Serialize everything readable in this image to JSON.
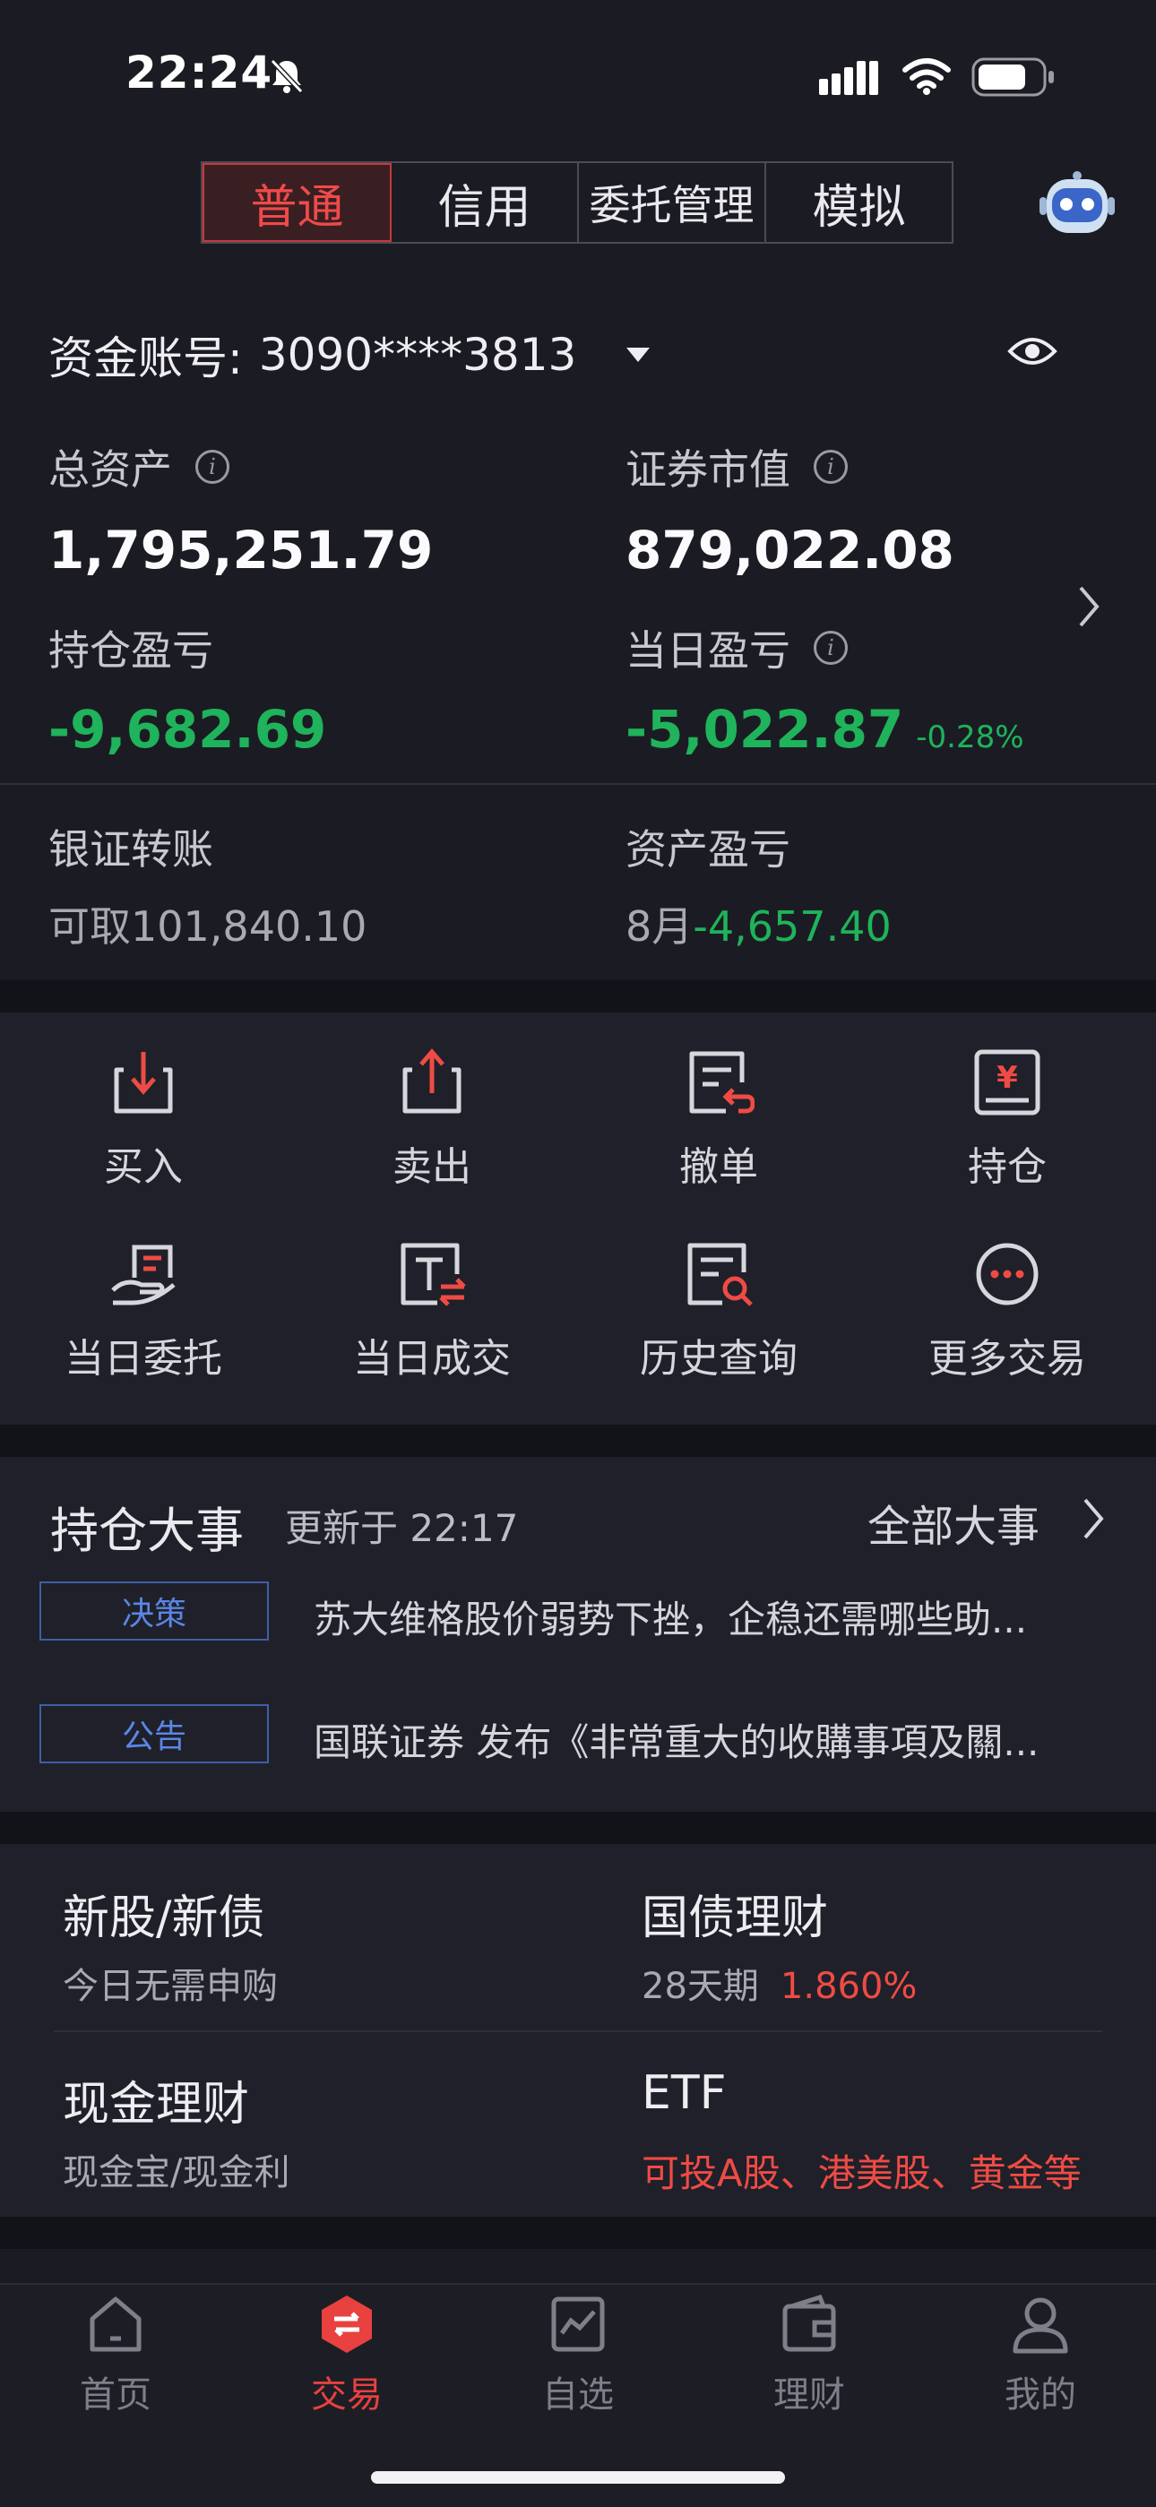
{
  "status": {
    "time": "22:24"
  },
  "tabs": [
    {
      "label": "普通",
      "active": true
    },
    {
      "label": "信用",
      "active": false
    },
    {
      "label": "委托管理",
      "active": false
    },
    {
      "label": "模拟",
      "active": false
    }
  ],
  "account": {
    "label": "资金账号:",
    "number": "3090****3813"
  },
  "summary": {
    "total_assets_label": "总资产",
    "total_assets": "1,795,251.79",
    "market_value_label": "证券市值",
    "market_value": "879,022.08",
    "position_pl_label": "持仓盈亏",
    "position_pl": "-9,682.69",
    "daily_pl_label": "当日盈亏",
    "daily_pl": "-5,022.87",
    "daily_pl_pct": "-0.28%",
    "bank_transfer_label": "银证转账",
    "withdrawable_prefix": "可取",
    "withdrawable": "101,840.10",
    "asset_pl_label": "资产盈亏",
    "asset_pl_month": "8月",
    "asset_pl": "-4,657.40"
  },
  "tools": [
    {
      "label": "买入",
      "icon": "buy-icon"
    },
    {
      "label": "卖出",
      "icon": "sell-icon"
    },
    {
      "label": "撤单",
      "icon": "cancel-order-icon"
    },
    {
      "label": "持仓",
      "icon": "holdings-icon"
    },
    {
      "label": "当日委托",
      "icon": "today-orders-icon"
    },
    {
      "label": "当日成交",
      "icon": "today-trades-icon"
    },
    {
      "label": "历史查询",
      "icon": "history-search-icon"
    },
    {
      "label": "更多交易",
      "icon": "more-icon"
    }
  ],
  "events": {
    "title": "持仓大事",
    "updated": "更新于 22:17",
    "all_label": "全部大事",
    "items": [
      {
        "tag": "决策",
        "text": "苏大维格股价弱势下挫，企稳还需哪些助..."
      },
      {
        "tag": "公告",
        "text": "国联证券 发布《非常重大的收購事項及關..."
      }
    ]
  },
  "products": [
    {
      "title": "新股/新债",
      "subtitle": "今日无需申购"
    },
    {
      "title": "国债理财",
      "subtitle_prefix": "28天期",
      "subtitle_value": "1.860%"
    },
    {
      "title": "现金理财",
      "subtitle": "现金宝/现金利"
    },
    {
      "title": "ETF",
      "subtitle": "可投A股、港美股、黄金等"
    }
  ],
  "nav": [
    {
      "label": "首页",
      "icon": "home-icon",
      "active": false
    },
    {
      "label": "交易",
      "icon": "trade-icon",
      "active": true
    },
    {
      "label": "自选",
      "icon": "watchlist-icon",
      "active": false
    },
    {
      "label": "理财",
      "icon": "wallet-icon",
      "active": false
    },
    {
      "label": "我的",
      "icon": "profile-icon",
      "active": false
    }
  ],
  "colors": {
    "up": "#ef4b45",
    "down": "#1fb35b",
    "accent": "#e8413f",
    "background": "#1b1c23"
  }
}
